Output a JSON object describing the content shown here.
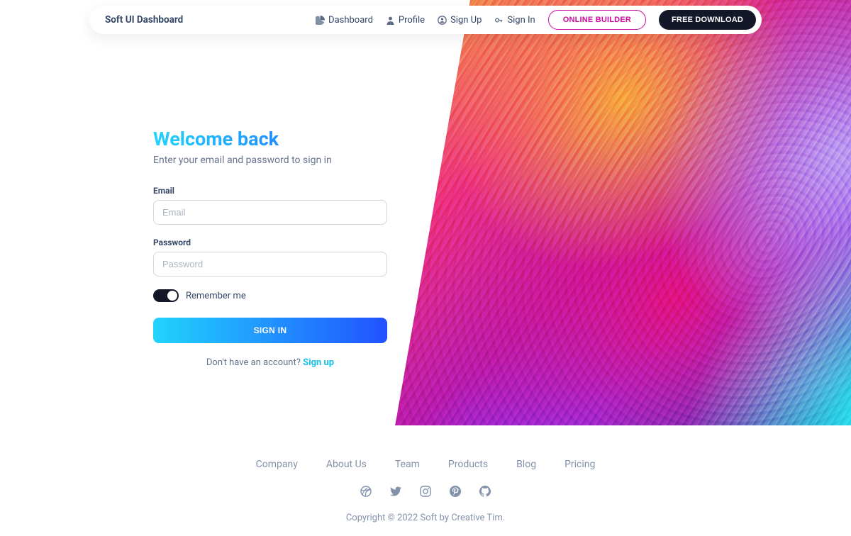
{
  "nav": {
    "brand": "Soft UI Dashboard",
    "links": [
      {
        "label": "Dashboard"
      },
      {
        "label": "Profile"
      },
      {
        "label": "Sign Up"
      },
      {
        "label": "Sign In"
      }
    ],
    "online_builder": "ONLINE BUILDER",
    "free_download": "FREE DOWNLOAD"
  },
  "form": {
    "title": "Welcome back",
    "subtitle": "Enter your email and password to sign in",
    "email_label": "Email",
    "email_placeholder": "Email",
    "password_label": "Password",
    "password_placeholder": "Password",
    "remember_label": "Remember me",
    "submit": "SIGN IN",
    "alt_text": "Don't have an account? ",
    "alt_link": "Sign up"
  },
  "footer": {
    "links": [
      "Company",
      "About Us",
      "Team",
      "Products",
      "Blog",
      "Pricing"
    ],
    "copyright": "Copyright © 2022 Soft by Creative Tim."
  }
}
